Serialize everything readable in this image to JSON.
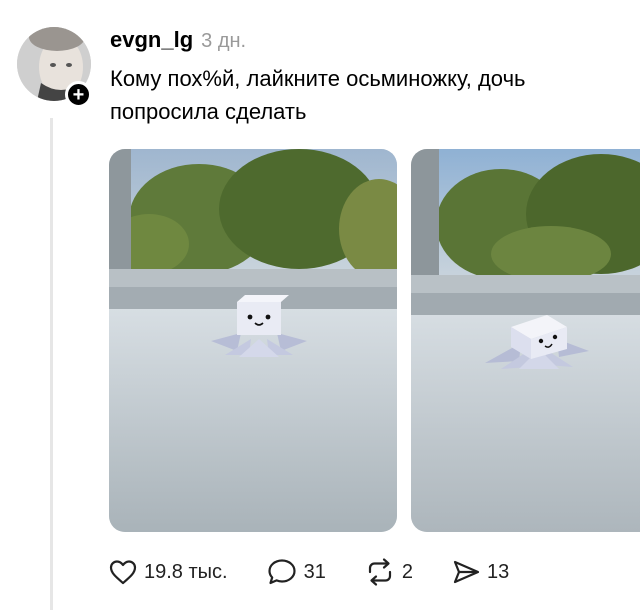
{
  "post": {
    "author": {
      "username": "evgn_lg",
      "avatar_icon": "user-photo-avatar",
      "follow_icon": "plus-icon"
    },
    "timestamp": "3 дн.",
    "text": "Кому пох%й, лайкните осьминожку, дочь попросила сделать",
    "media": [
      {
        "type": "photo",
        "description_icon": "origami-octopus-photo"
      },
      {
        "type": "photo",
        "description_icon": "origami-octopus-photo"
      }
    ],
    "actions": {
      "likes": "19.8 тыс.",
      "comments": "31",
      "reposts": "2",
      "shares": "13"
    }
  },
  "colors": {
    "text": "#000000",
    "muted": "#9a9a9a",
    "thread_line": "#e6e6e6"
  }
}
